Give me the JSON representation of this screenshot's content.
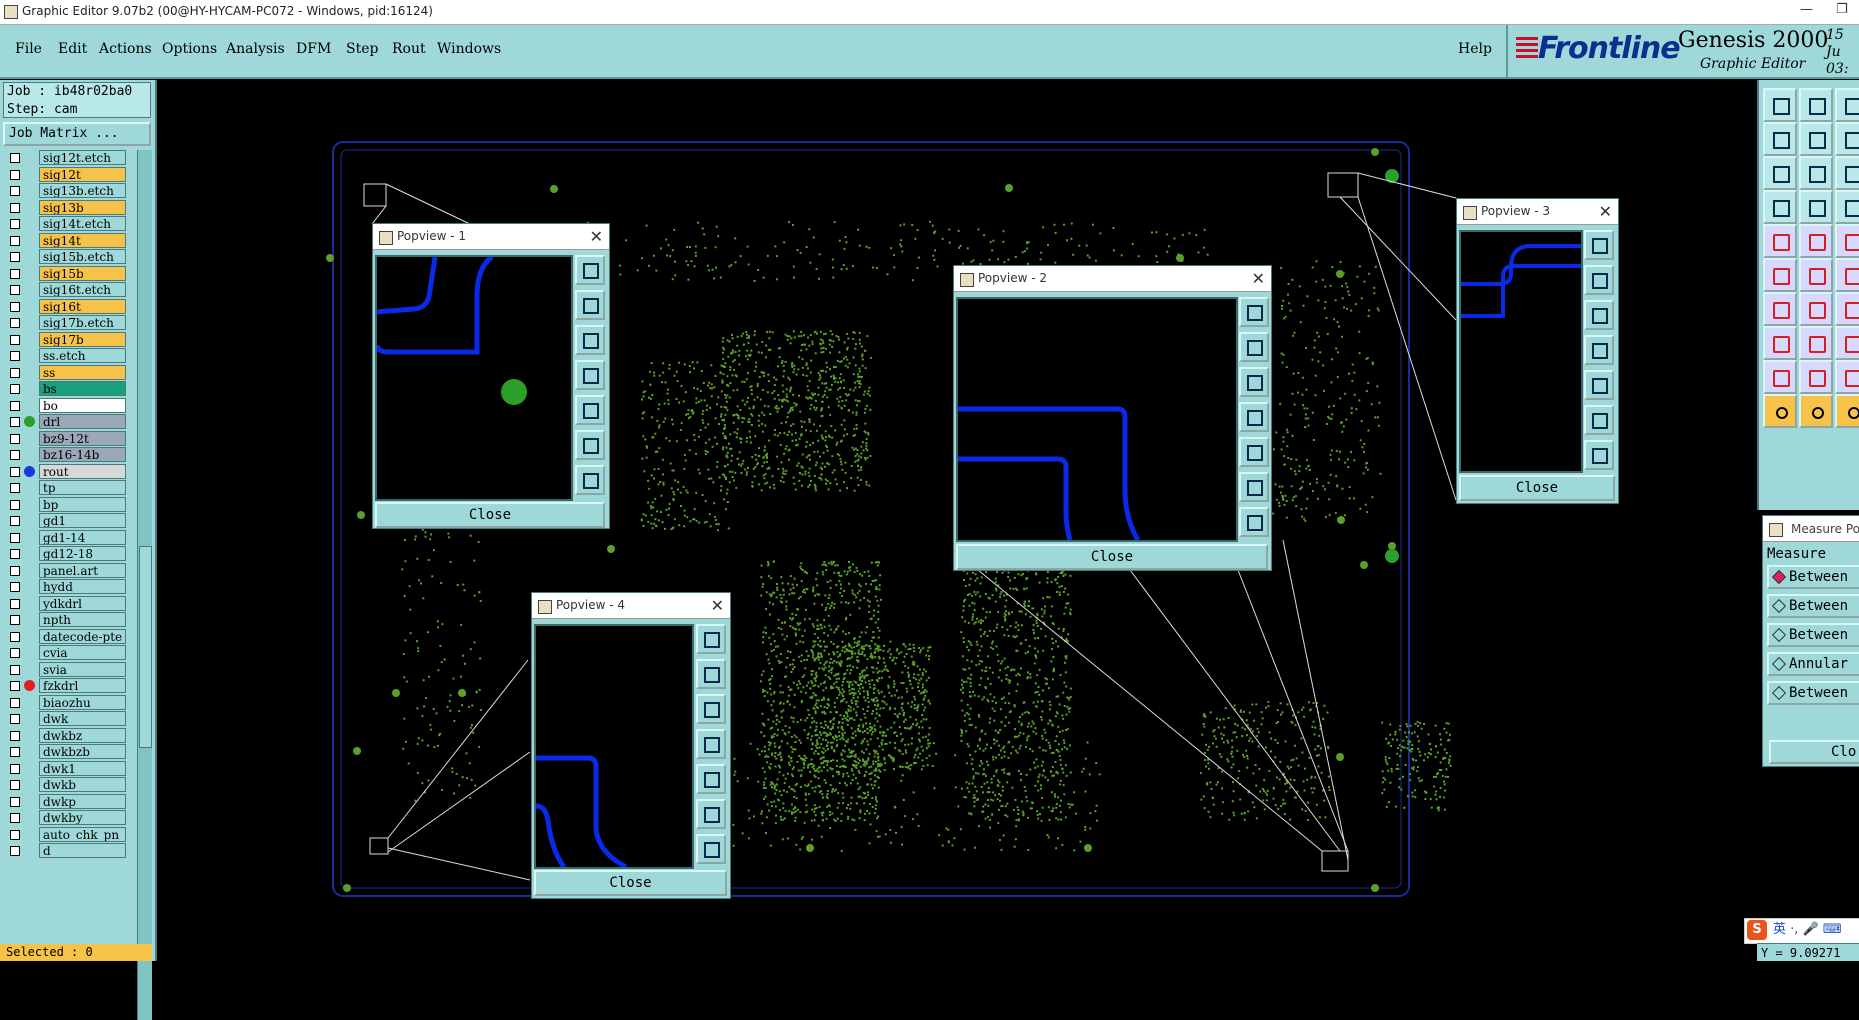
{
  "window": {
    "title": "Graphic Editor 9.07b2 (00@HY-HYCAM-PC072 - Windows, pid:16124)",
    "minimize_glyph": "—",
    "restore_glyph": "❐"
  },
  "menu": {
    "items": [
      "File",
      "Edit",
      "Actions",
      "Options",
      "Analysis",
      "DFM",
      "Step",
      "Rout",
      "Windows"
    ],
    "help": "Help"
  },
  "logo": {
    "brand": "Frontline",
    "product": "Genesis 2000",
    "subtitle": "Graphic Editor",
    "date_line1": "15 Ju",
    "date_line2": "03:"
  },
  "job": {
    "job_line": "Job : ib48r02ba0",
    "step_line": "Step: cam",
    "matrix_button": "Job Matrix ..."
  },
  "layers": [
    {
      "name": "sig12t.etch",
      "color": "#9ed8d8"
    },
    {
      "name": "sig12t",
      "color": "#f6c24a"
    },
    {
      "name": "sig13b.etch",
      "color": "#9ed8d8"
    },
    {
      "name": "sig13b",
      "color": "#f6c24a"
    },
    {
      "name": "sig14t.etch",
      "color": "#9ed8d8"
    },
    {
      "name": "sig14t",
      "color": "#f6c24a"
    },
    {
      "name": "sig15b.etch",
      "color": "#9ed8d8"
    },
    {
      "name": "sig15b",
      "color": "#f6c24a"
    },
    {
      "name": "sig16t.etch",
      "color": "#9ed8d8"
    },
    {
      "name": "sig16t",
      "color": "#f6c24a"
    },
    {
      "name": "sig17b.etch",
      "color": "#9ed8d8"
    },
    {
      "name": "sig17b",
      "color": "#f6c24a"
    },
    {
      "name": "ss.etch",
      "color": "#9ed8d8"
    },
    {
      "name": "ss",
      "color": "#f6c24a"
    },
    {
      "name": "bs",
      "color": "#1aa07a"
    },
    {
      "name": "bo",
      "color": "#ffffff"
    },
    {
      "name": "drl",
      "color": "#9aa8b8",
      "dot": "#2aa02a"
    },
    {
      "name": "bz9-12t",
      "color": "#9aa8b8"
    },
    {
      "name": "bz16-14b",
      "color": "#9aa8b8"
    },
    {
      "name": "rout",
      "color": "#d8d8d8",
      "dot": "#1a3adc"
    },
    {
      "name": "tp",
      "color": "#9ed8d8"
    },
    {
      "name": "bp",
      "color": "#9ed8d8"
    },
    {
      "name": "gd1",
      "color": "#9ed8d8"
    },
    {
      "name": "gd1-14",
      "color": "#9ed8d8"
    },
    {
      "name": "gd12-18",
      "color": "#9ed8d8"
    },
    {
      "name": "panel.art",
      "color": "#9ed8d8"
    },
    {
      "name": "hydd",
      "color": "#9ed8d8"
    },
    {
      "name": "ydkdrl",
      "color": "#9ed8d8"
    },
    {
      "name": "npth",
      "color": "#9ed8d8"
    },
    {
      "name": "datecode-pte",
      "color": "#9ed8d8"
    },
    {
      "name": "cvia",
      "color": "#9ed8d8"
    },
    {
      "name": "svia",
      "color": "#9ed8d8"
    },
    {
      "name": "fzkdrl",
      "color": "#9ed8d8",
      "dot": "#e02020"
    },
    {
      "name": "biaozhu",
      "color": "#9ed8d8"
    },
    {
      "name": "dwk",
      "color": "#9ed8d8"
    },
    {
      "name": "dwkbz",
      "color": "#9ed8d8"
    },
    {
      "name": "dwkbzb",
      "color": "#9ed8d8"
    },
    {
      "name": "dwk1",
      "color": "#9ed8d8"
    },
    {
      "name": "dwkb",
      "color": "#9ed8d8"
    },
    {
      "name": "dwkp",
      "color": "#9ed8d8"
    },
    {
      "name": "dwkby",
      "color": "#9ed8d8"
    },
    {
      "name": "auto_chk_pn",
      "color": "#9ed8d8"
    },
    {
      "name": "d",
      "color": "#9ed8d8"
    }
  ],
  "status": {
    "selected": "Selected : 0",
    "coordinate": "Y = 9.09271"
  },
  "popviews": [
    {
      "title": "Popview - 1",
      "close": "Close",
      "close_glyph": "✕"
    },
    {
      "title": "Popview - 2",
      "close": "Close",
      "close_glyph": "✕"
    },
    {
      "title": "Popview - 3",
      "close": "Close",
      "close_glyph": "✕"
    },
    {
      "title": "Popview - 4",
      "close": "Close",
      "close_glyph": "✕"
    }
  ],
  "measure": {
    "title": "Measure Po",
    "heading": "Measure",
    "options": [
      "Between",
      "Between",
      "Between",
      "Annular",
      "Between"
    ],
    "close": "Clo"
  },
  "ime": {
    "badge": "S",
    "text": "英 ·, 🎤 ⌨"
  },
  "colors": {
    "panel": "#9ed8d8",
    "board_outline": "#1a2a9a",
    "trace": "#0a2ae8",
    "copper": "#5aa02a",
    "highlight": "#f6c24a"
  }
}
